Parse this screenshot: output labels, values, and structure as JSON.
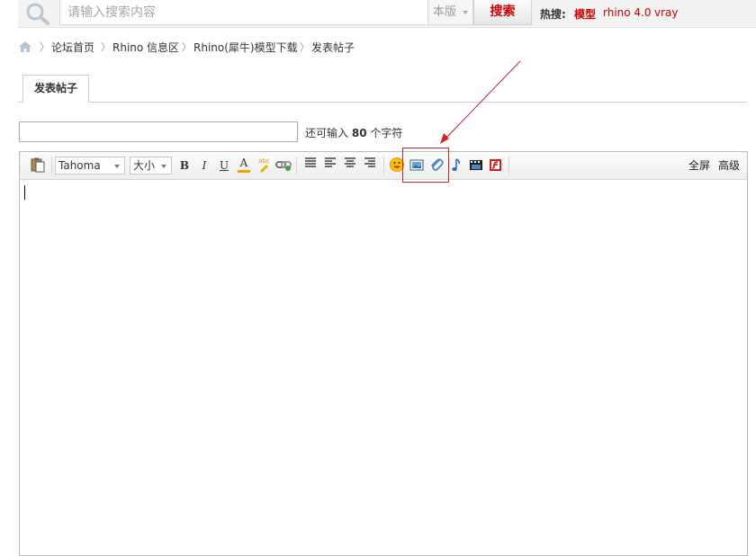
{
  "search": {
    "placeholder": "请输入搜索内容",
    "scope_label": "本版",
    "button_label": "搜索",
    "hot_label": "热搜:",
    "hot_links": [
      "模型",
      "rhino 4.0",
      "vray"
    ]
  },
  "breadcrumb": {
    "items": [
      "论坛首页",
      "Rhino 信息区",
      "Rhino(犀牛)模型下载",
      "发表帖子"
    ]
  },
  "tabs": {
    "active_label": "发表帖子"
  },
  "subject": {
    "value": "",
    "hint_prefix": "还可输入",
    "hint_count": "80",
    "hint_suffix": "个字符"
  },
  "editor": {
    "font_select": "Tahoma",
    "size_select": "大小",
    "bold_label": "B",
    "italic_label": "I",
    "underline_label": "U",
    "fontcolor_label": "A",
    "fullscreen_label": "全屏",
    "advanced_label": "高级",
    "body_text": ""
  },
  "colors": {
    "accent_red": "#cc0000",
    "annotation_red": "#d0212b"
  }
}
